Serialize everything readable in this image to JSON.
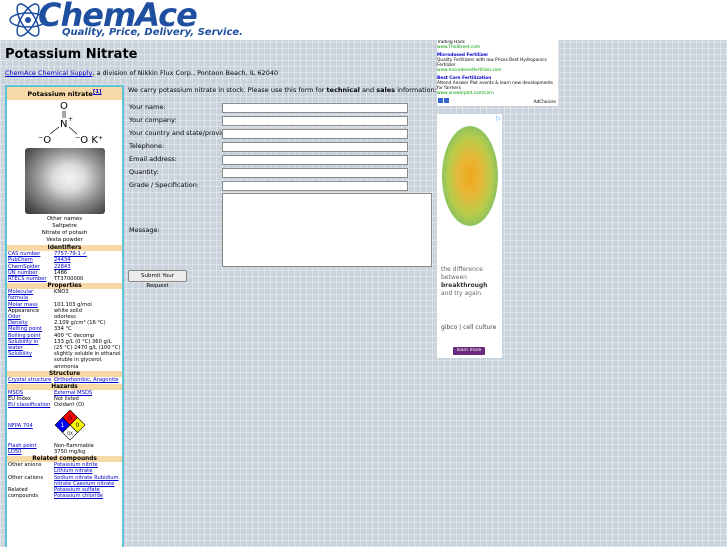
{
  "header": {
    "logo_name": "ChemAce",
    "tagline": "Quality, Price, Delivery, Service."
  },
  "page_title": "Potassium Nitrate",
  "intro": {
    "link": "ChemAce Chemical Supply",
    "rest": ", a division of Nikkin Flux Corp., Pontoon Beach, IL 62040"
  },
  "infobox": {
    "title": "Potassium nitrate",
    "title_ref": "[1]",
    "other_names_label": "Other names",
    "other_names": [
      "Saltpetre",
      "Nitrate of potash",
      "Vesta powder"
    ],
    "sections": [
      {
        "heading": "Identifiers",
        "rows": [
          {
            "k": "CAS number",
            "v": "7757-79-1 ✓"
          },
          {
            "k": "PubChem",
            "v": "24434"
          },
          {
            "k": "ChemSpider",
            "v": "22843"
          },
          {
            "k": "UN number",
            "v": "1486"
          },
          {
            "k": "RTECS number",
            "v": "TT3700000"
          }
        ]
      },
      {
        "heading": "Properties",
        "rows": [
          {
            "k": "Molecular formula",
            "v": "KNO3"
          },
          {
            "k": "Molar mass",
            "v": "101.103 g/mol"
          },
          {
            "k": "Appearance",
            "v": "white solid"
          },
          {
            "k": "Odor",
            "v": "odorless"
          },
          {
            "k": "Density",
            "v": "2.109 g/cm³ (16 °C)"
          },
          {
            "k": "Melting point",
            "v": "334 °C"
          },
          {
            "k": "Boiling point",
            "v": "400 °C decomp"
          },
          {
            "k": "Solubility in water",
            "v": "133 g/L (0 °C) 360 g/L (25 °C) 2470 g/L (100 °C)"
          },
          {
            "k": "Solubility",
            "v": "slightly soluble in ethanol soluble in glycerol, ammonia"
          }
        ]
      },
      {
        "heading": "Structure",
        "rows": [
          {
            "k": "Crystal structure",
            "v": "Orthorhombic, Aragonite"
          }
        ]
      },
      {
        "heading": "Hazards",
        "rows": [
          {
            "k": "MSDS",
            "v": "External MSDS"
          },
          {
            "k": "EU Index",
            "v": "Not listed"
          },
          {
            "k": "EU classification",
            "v": "Oxidant (O)"
          },
          {
            "k": "NFPA 704",
            "v": ""
          },
          {
            "k": "Flash point",
            "v": "Non-flammable"
          },
          {
            "k": "LD50",
            "v": "3750 mg/kg"
          }
        ]
      },
      {
        "heading": "Related compounds",
        "rows": [
          {
            "k": "Other anions",
            "v": "Potassium nitrite"
          },
          {
            "k": "",
            "v": "Lithium nitrate"
          },
          {
            "k": "Other cations",
            "v": "Sodium nitrate Rubidium nitrate Caesium nitrate"
          },
          {
            "k": "Related compounds",
            "v": "Potassium sulfate Potassium chloride"
          }
        ]
      }
    ],
    "nfpa": {
      "top": "0",
      "left": "1",
      "right": "0",
      "bottom": "OX",
      "colors": {
        "top": "#ff0000",
        "left": "#0000ff",
        "right": "#ffff00",
        "bottom": "#ffffff"
      }
    }
  },
  "form": {
    "intro_prefix": "We carry potassium nitrate in stock. Please use this form for ",
    "intro_b1": "technical",
    "intro_mid": " and ",
    "intro_b2": "sales",
    "intro_suffix": " information:",
    "fields": [
      "Your name:",
      "Your company:",
      "Your country and state/province:",
      "Telephone:",
      "Email address:",
      "Quantity:",
      "Grade / Specification:"
    ],
    "message_label": "Message:",
    "submit": "Submit Your Request"
  },
  "ad_top": {
    "line1": "Trading Hack",
    "line1_url": "www.TheStreet.com",
    "ad2_title": "Microdosed Fertilizer",
    "ad2_text": "Quality Fertilizers with low Prices Best Hydroponics Fertilizer",
    "ad2_url": "www.microdosedfertilizer.com",
    "ad3_title": "Best Corn Fertilization",
    "ad3_text": "Attend Answer Plot events & learn new developments for farmers",
    "ad3_url": "www.answerplot.com/corn",
    "adchoices": "AdChoices"
  },
  "ad_img": {
    "line1": "the difference",
    "line2": "between",
    "line3": "breakthrough",
    "line4": "and try again",
    "brand": "gibco | cell culture",
    "button": "learn more"
  },
  "colors": {
    "accent": "#1f4fa0",
    "infobox_border": "#5ec3d6",
    "section_bg": "#f7d9a8"
  }
}
